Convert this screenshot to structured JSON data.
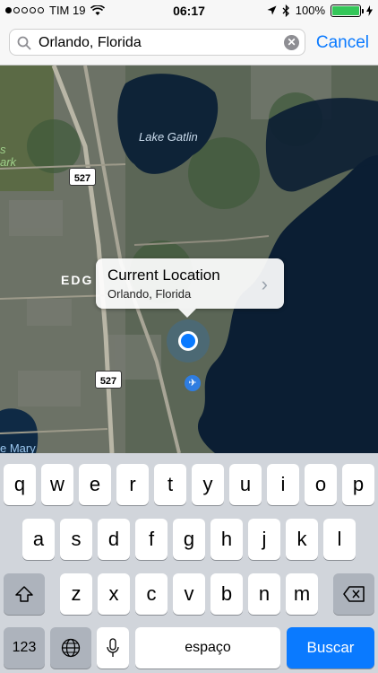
{
  "status_bar": {
    "carrier": "TIM 19",
    "time": "06:17",
    "battery": "100%"
  },
  "search": {
    "value": "Orlando, Florida",
    "cancel_label": "Cancel"
  },
  "map": {
    "labels": {
      "lake_gatlin": "Lake Gatlin",
      "edge": "EDG",
      "mary": "e Mary",
      "park": "ark",
      "s": "s"
    },
    "highway_shields": [
      "527",
      "527"
    ],
    "callout": {
      "title": "Current Location",
      "subtitle": "Orlando, Florida"
    }
  },
  "keyboard": {
    "row1": [
      "q",
      "w",
      "e",
      "r",
      "t",
      "y",
      "u",
      "i",
      "o",
      "p"
    ],
    "row2": [
      "a",
      "s",
      "d",
      "f",
      "g",
      "h",
      "j",
      "k",
      "l"
    ],
    "row3": [
      "z",
      "x",
      "c",
      "v",
      "b",
      "n",
      "m"
    ],
    "numbers_label": "123",
    "space_label": "espaço",
    "return_label": "Buscar"
  },
  "colors": {
    "accent": "#0a7aff",
    "battery": "#34c759"
  }
}
